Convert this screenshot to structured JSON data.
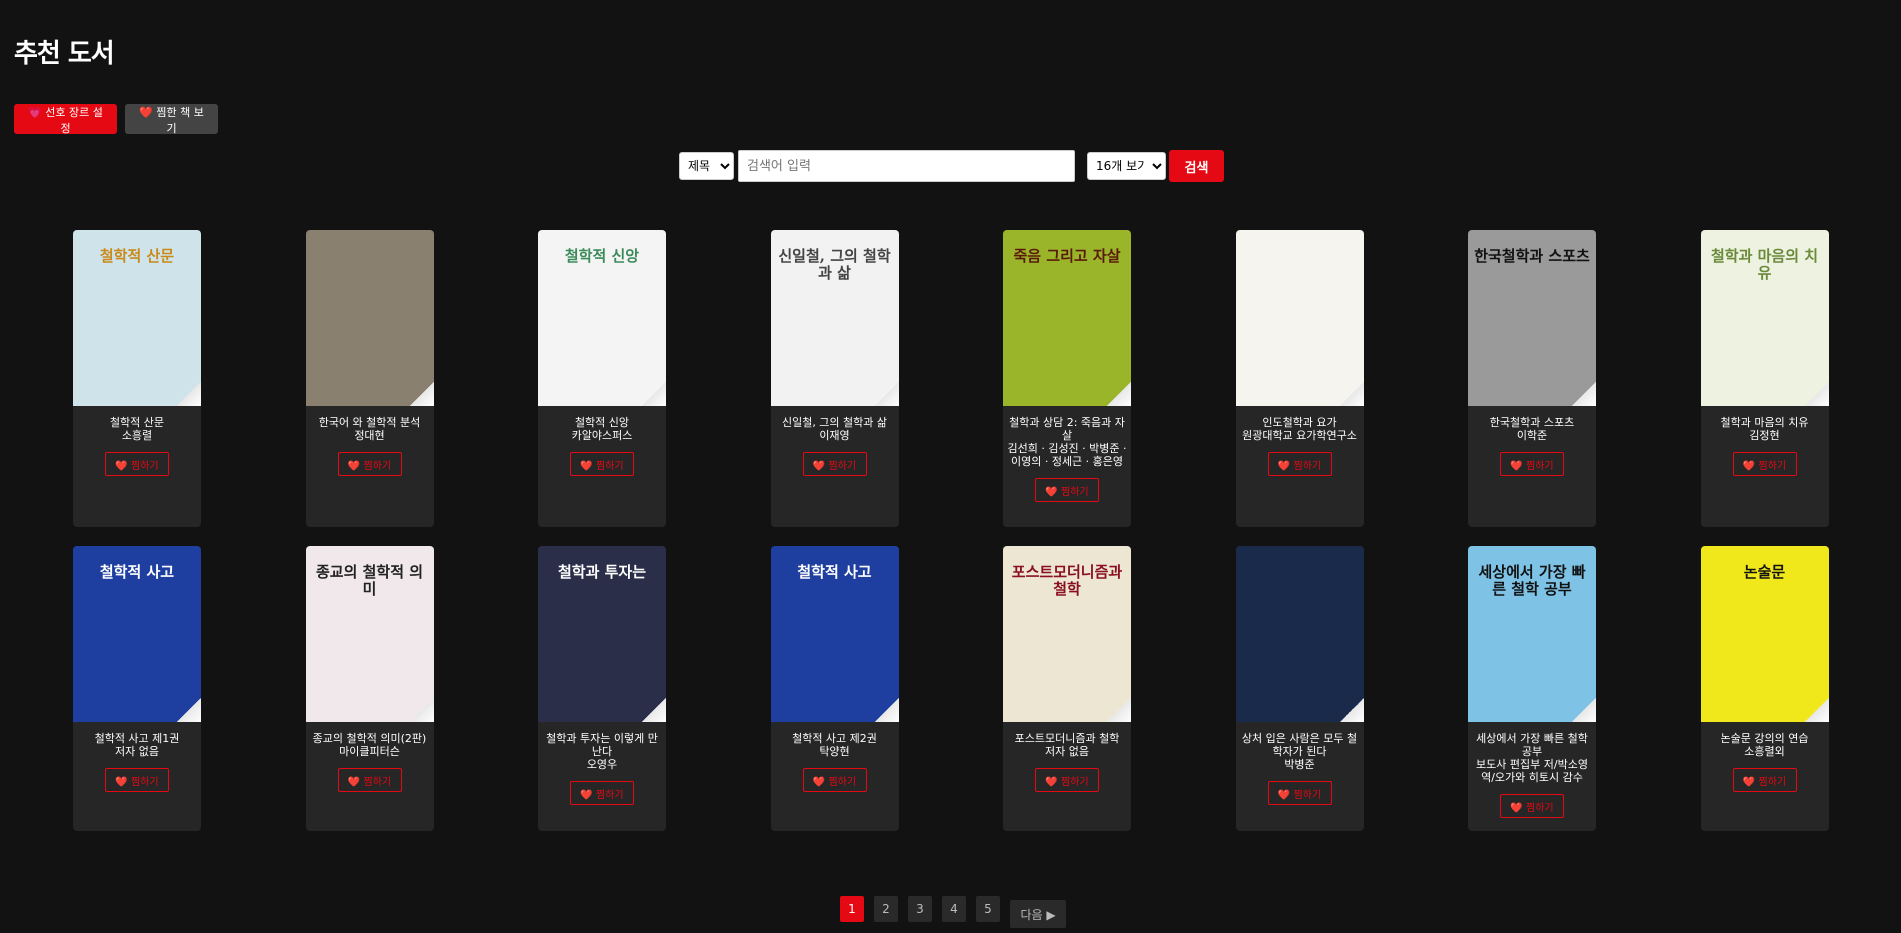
{
  "page": {
    "title": "추천 도서"
  },
  "toolbar": {
    "genre_button": "💗 선호 장르 설정",
    "favorites_button": "❤️ 찜한 책 보기"
  },
  "search": {
    "field_options": [
      "제목"
    ],
    "field_selected": "제목",
    "placeholder": "검색어 입력",
    "value": "",
    "count_selected": "16개 보기",
    "button": "검색"
  },
  "favorite_label": "❤️ 찜하기",
  "books": [
    {
      "title": "철학적 산문",
      "author": "소흥렬",
      "cover_bg": "#cfe4ea",
      "cover_fg": "#c98a1a",
      "cover_text": "철학적 산문"
    },
    {
      "title": "한국어 와 철학적 분석",
      "author": "정대현",
      "cover_bg": "#8a8070",
      "cover_fg": "#222222",
      "cover_text": ""
    },
    {
      "title": "철학적 신앙",
      "author": "카알야스퍼스",
      "cover_bg": "#f4f4f4",
      "cover_fg": "#3b8a5a",
      "cover_text": "철학적 신앙"
    },
    {
      "title": "신일철, 그의 철학과 삶",
      "author": "이재영",
      "cover_bg": "#f2f2f2",
      "cover_fg": "#444444",
      "cover_text": "신일철, 그의 철학과 삶"
    },
    {
      "title": "철학과 상담 2: 죽음과 자살",
      "author": "김선희 · 김성진 · 박병준 · 이영의 · 정세근 · 홍은영",
      "cover_bg": "#9bb52a",
      "cover_fg": "#5a1a0a",
      "cover_text": "죽음 그리고 자살"
    },
    {
      "title": "인도철학과 요가",
      "author": "원광대학교 요가학연구소",
      "cover_bg": "#f6f4ee",
      "cover_fg": "#555555",
      "cover_text": ""
    },
    {
      "title": "한국철학과 스포츠",
      "author": "이학준",
      "cover_bg": "#9a9a9a",
      "cover_fg": "#111111",
      "cover_text": "한국철학과 스포츠"
    },
    {
      "title": "철학과 마음의 치유",
      "author": "김정현",
      "cover_bg": "#eef2e0",
      "cover_fg": "#6a8a3a",
      "cover_text": "철학과 마음의 치유"
    },
    {
      "title": "철학적 사고 제1권",
      "author": "저자 없음",
      "cover_bg": "#1e3fa0",
      "cover_fg": "#ffffff",
      "cover_text": "철학적 사고"
    },
    {
      "title": "종교의 철학적 의미(2판)",
      "author": "마이클피터슨",
      "cover_bg": "#f0e8ea",
      "cover_fg": "#222222",
      "cover_text": "종교의 철학적 의미"
    },
    {
      "title": "철학과 투자는 이렇게 만난다",
      "author": "오영우",
      "cover_bg": "#2a2e48",
      "cover_fg": "#ffffff",
      "cover_text": "철학과 투자는"
    },
    {
      "title": "철학적 사고 제2권",
      "author": "탁양현",
      "cover_bg": "#1e3fa0",
      "cover_fg": "#ffffff",
      "cover_text": "철학적 사고"
    },
    {
      "title": "포스트모더니즘과 철학",
      "author": "저자 없음",
      "cover_bg": "#ece6d2",
      "cover_fg": "#8a1020",
      "cover_text": "포스트모더니즘과 철학"
    },
    {
      "title": "상처 입은 사람은 모두 철학자가 된다",
      "author": "박병준",
      "cover_bg": "#1a2a4a",
      "cover_fg": "#dddddd",
      "cover_text": ""
    },
    {
      "title": "세상에서 가장 빠른 철학 공부",
      "author": "보도사 편집부 저/박소영 역/오가와 히토시 감수",
      "cover_bg": "#7ec3e6",
      "cover_fg": "#111111",
      "cover_text": "세상에서 가장 빠른 철학 공부"
    },
    {
      "title": "논술문 강의의 연습",
      "author": "소흥렬외",
      "cover_bg": "#f0e81a",
      "cover_fg": "#111111",
      "cover_text": "논술문"
    }
  ],
  "pagination": {
    "pages": [
      "1",
      "2",
      "3",
      "4",
      "5"
    ],
    "active": "1",
    "next": "다음 ▶"
  }
}
